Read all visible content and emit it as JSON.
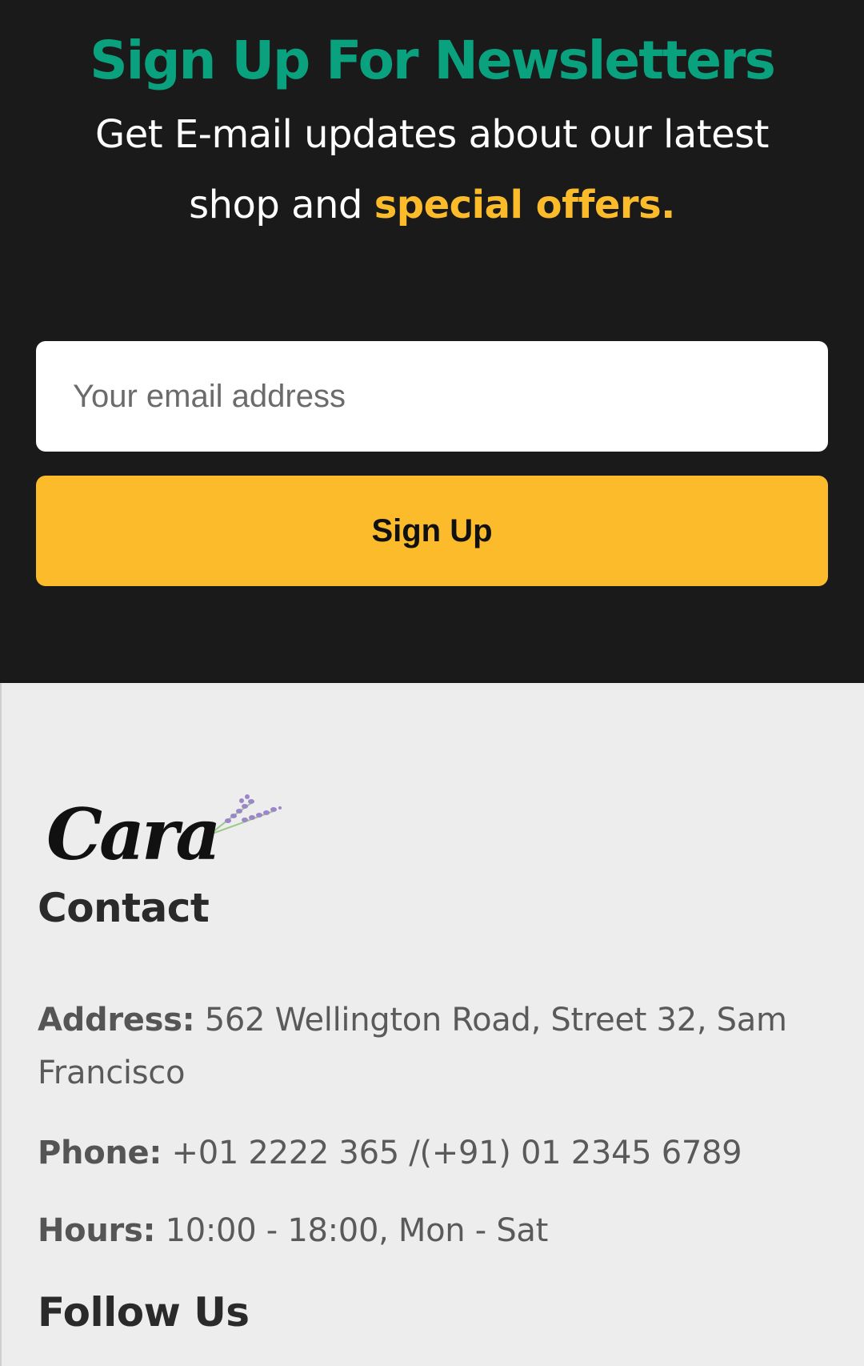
{
  "newsletter": {
    "title": "Sign Up For Newsletters",
    "subtitle_text": "Get E-mail updates about our latest shop and ",
    "subtitle_highlight": "special offers.",
    "email_placeholder": "Your email address",
    "button_label": "Sign Up"
  },
  "footer": {
    "logo_text": "Cara",
    "contact_heading": "Contact",
    "address_label": "Address:",
    "address_value": " 562 Wellington Road, Street 32, Sam Francisco",
    "phone_label": "Phone:",
    "phone_value": " +01 2222 365 /(+91) 01 2345 6789",
    "hours_label": "Hours:",
    "hours_value": " 10:00 - 18:00, Mon - Sat",
    "follow_heading": "Follow Us"
  },
  "colors": {
    "newsletter_bg": "#1a1a1a",
    "title_green": "#0aa17e",
    "accent_yellow": "#fbbb2a",
    "footer_bg": "#ededed"
  }
}
